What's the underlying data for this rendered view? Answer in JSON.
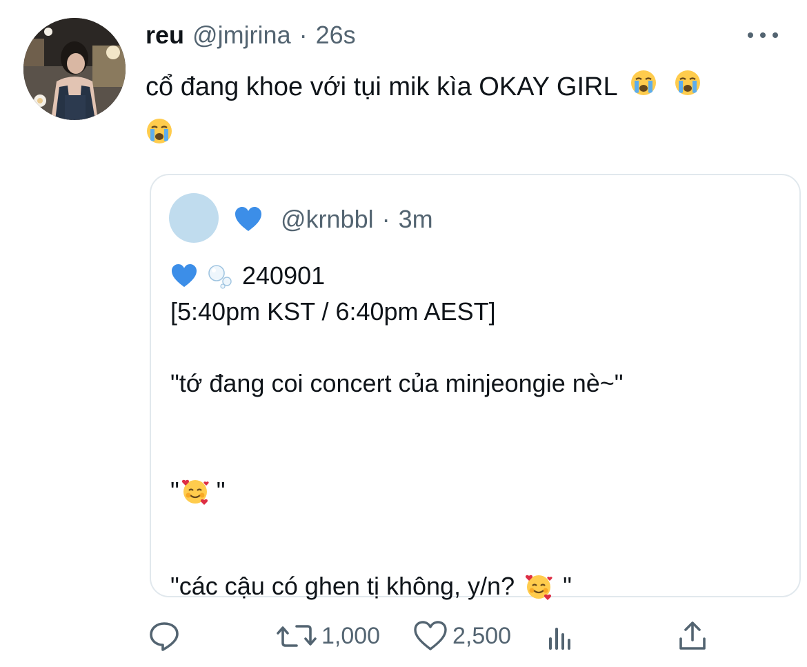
{
  "tweet": {
    "display_name": "reu",
    "handle": "@jmjrina",
    "separator": "·",
    "time": "26s",
    "text": "cổ đang khoe với tụi mik kìa OKAY GIRL",
    "trailing_emojis": [
      "loudly-crying-face",
      "loudly-crying-face",
      "loudly-crying-face"
    ]
  },
  "quoted_tweet": {
    "display_name_emoji": "blue-heart",
    "handle": "@krnbbl",
    "separator": "·",
    "time": "3m",
    "lines": [
      {
        "emojis": [
          "blue-heart",
          "bubbles"
        ],
        "text": "240901"
      },
      {
        "text": "[5:40pm KST / 6:40pm AEST]"
      },
      {
        "text": "\"tớ đang coi concert của minjeongie nè~\""
      },
      {
        "before": "\"",
        "emoji": "smiling-face-with-hearts",
        "after": "\""
      },
      {
        "before": "\"các cậu có ghen tị không, y/n?",
        "emoji": "smiling-face-with-hearts",
        "after": "\""
      }
    ]
  },
  "actions": {
    "reply_count": "",
    "retweet_count": "1,000",
    "like_count": "2,500"
  },
  "colors": {
    "text_primary": "#0f1419",
    "text_secondary": "#536471",
    "card_border": "#e1e8ed",
    "quote_avatar": "#c0dcee",
    "heart_blue": "#3c8ee8"
  }
}
